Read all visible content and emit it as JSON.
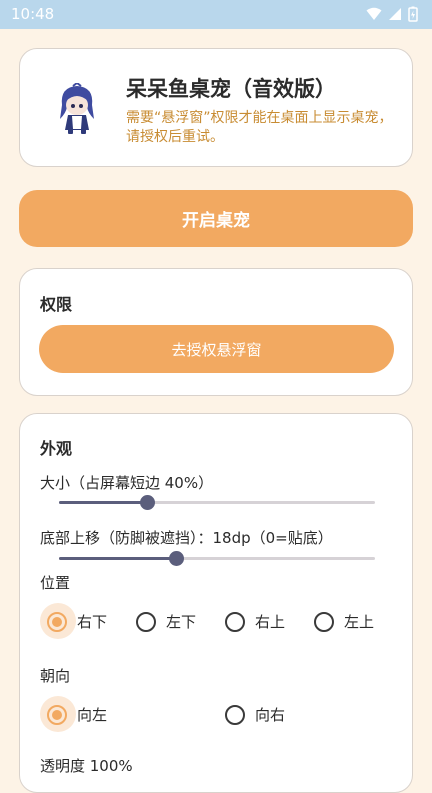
{
  "status_bar": {
    "time": "10:48"
  },
  "header": {
    "title": "呆呆鱼桌宠（音效版）",
    "notice": "需要“悬浮窗”权限才能在桌面上显示桌宠，请授权后重试。"
  },
  "start_button": {
    "label": "开启桌宠"
  },
  "permission": {
    "title": "权限",
    "button_label": "去授权悬浮窗"
  },
  "appearance": {
    "title": "外观",
    "size_label": "大小（占屏幕短边 40%）",
    "size_percent": 40,
    "size_slider_fraction": 0.28,
    "offset_label": "底部上移（防脚被遮挡）：18dp（0=贴底）",
    "offset_slider_fraction": 0.37,
    "position_label": "位置",
    "positions": [
      "右下",
      "左下",
      "右上",
      "左上"
    ],
    "position_selected": "右下",
    "direction_label": "朝向",
    "directions": [
      "向左",
      "向右"
    ],
    "direction_selected": "向左",
    "opacity_label": "透明度 100%"
  },
  "colors": {
    "accent": "#F2A961",
    "slider": "#5B5E7C",
    "notice": "#C88C33",
    "background": "#FDF3E6",
    "status_bar": "#B9D7EC"
  }
}
